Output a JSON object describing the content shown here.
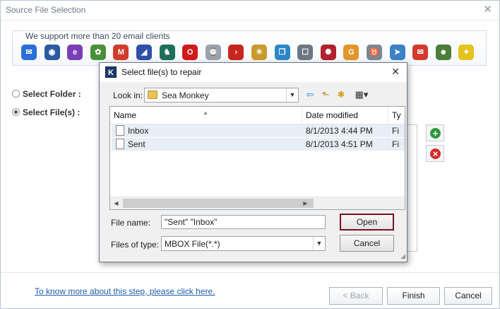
{
  "window": {
    "title": "Source File Selection",
    "close_glyph": "✕"
  },
  "clients": {
    "label": "We support more than 20 email clients",
    "icons": [
      {
        "name": "mail-client-icon",
        "color": "#2a6fd6",
        "glyph": "✉"
      },
      {
        "name": "thunderbird-icon",
        "color": "#2b5aa0",
        "glyph": "◉"
      },
      {
        "name": "eudora-icon",
        "color": "#7b3fb5",
        "glyph": "e"
      },
      {
        "name": "entourage-icon",
        "color": "#4a8f3a",
        "glyph": "✿"
      },
      {
        "name": "gmail-icon",
        "color": "#d23b2b",
        "glyph": "M"
      },
      {
        "name": "postbox-icon",
        "color": "#2f4fa8",
        "glyph": "◢"
      },
      {
        "name": "seamonkey-icon",
        "color": "#1f6f5a",
        "glyph": "♞"
      },
      {
        "name": "opera-icon",
        "color": "#d11a1a",
        "glyph": "O"
      },
      {
        "name": "mailbox-icon",
        "color": "#9aa3ad",
        "glyph": "⌚"
      },
      {
        "name": "powermail-icon",
        "color": "#c7261e",
        "glyph": "›"
      },
      {
        "name": "spicebird-icon",
        "color": "#c99a2e",
        "glyph": "☀"
      },
      {
        "name": "apple-mail-icon",
        "color": "#2d86c8",
        "glyph": "❐"
      },
      {
        "name": "netscape-icon",
        "color": "#6b7784",
        "glyph": "☐"
      },
      {
        "name": "pocomail-icon",
        "color": "#b3212f",
        "glyph": "✺"
      },
      {
        "name": "gyazmail-icon",
        "color": "#e0962a",
        "glyph": "G"
      },
      {
        "name": "gnu-mail-icon",
        "color": "#7d8590",
        "glyph": "♉"
      },
      {
        "name": "sylpheed-icon",
        "color": "#3b82c6",
        "glyph": "➤"
      },
      {
        "name": "mail-envelope-icon",
        "color": "#d23b2b",
        "glyph": "✉"
      },
      {
        "name": "claws-mail-icon",
        "color": "#4c7d3a",
        "glyph": "☻"
      },
      {
        "name": "the-bat-icon",
        "color": "#e5c21d",
        "glyph": "✦"
      }
    ]
  },
  "options": {
    "folder_label": "Select Folder :",
    "files_label": "Select File(s) :"
  },
  "footer": {
    "help_link": "To know more about this step, please click here.",
    "back": "< Back",
    "finish": "Finish",
    "cancel": "Cancel"
  },
  "dialog": {
    "logo": "K",
    "title": "Select file(s) to repair",
    "close_glyph": "✕",
    "lookin_label": "Look in:",
    "lookin_value": "Sea Monkey",
    "columns": {
      "name": "Name",
      "date": "Date modified",
      "type": "Ty"
    },
    "files": [
      {
        "name": "Inbox",
        "date": "8/1/2013 4:44 PM",
        "type": "Fi"
      },
      {
        "name": "Sent",
        "date": "8/1/2013 4:51 PM",
        "type": "Fi"
      }
    ],
    "filename_label": "File name:",
    "filename_value": "\"Sent\" \"Inbox\"",
    "filetype_label": "Files of type:",
    "filetype_value": "MBOX File(*.*)",
    "open": "Open",
    "cancel": "Cancel"
  }
}
